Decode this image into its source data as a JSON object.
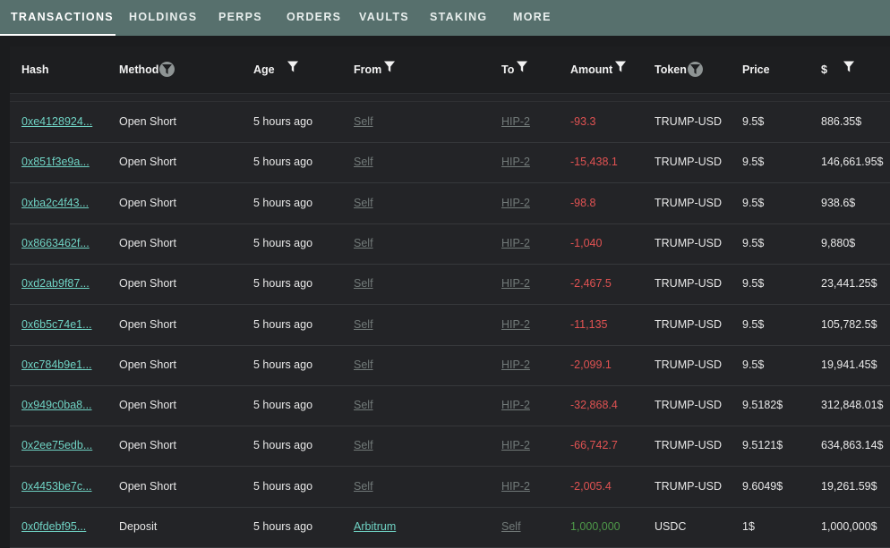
{
  "tabs": [
    {
      "label": "TRANSACTIONS",
      "active": true
    },
    {
      "label": "HOLDINGS"
    },
    {
      "label": "PERPS"
    },
    {
      "label": "ORDERS"
    },
    {
      "label": "VAULTS"
    },
    {
      "label": "STAKING"
    },
    {
      "label": "MORE"
    }
  ],
  "columns": {
    "hash": "Hash",
    "method": "Method",
    "age": "Age",
    "from": "From",
    "to": "To",
    "amount": "Amount",
    "token": "Token",
    "price": "Price",
    "usd": "$"
  },
  "rows": [
    {
      "hash": "0xe4128924...",
      "method": "Open Short",
      "age": "5 hours ago",
      "from": "Self",
      "to": "HIP-2",
      "amount": "-93.3",
      "token": "TRUMP-USD",
      "price": "9.5$",
      "usd": "886.35$"
    },
    {
      "hash": "0x851f3e9a...",
      "method": "Open Short",
      "age": "5 hours ago",
      "from": "Self",
      "to": "HIP-2",
      "amount": "-15,438.1",
      "token": "TRUMP-USD",
      "price": "9.5$",
      "usd": "146,661.95$"
    },
    {
      "hash": "0xba2c4f43...",
      "method": "Open Short",
      "age": "5 hours ago",
      "from": "Self",
      "to": "HIP-2",
      "amount": "-98.8",
      "token": "TRUMP-USD",
      "price": "9.5$",
      "usd": "938.6$"
    },
    {
      "hash": "0x8663462f...",
      "method": "Open Short",
      "age": "5 hours ago",
      "from": "Self",
      "to": "HIP-2",
      "amount": "-1,040",
      "token": "TRUMP-USD",
      "price": "9.5$",
      "usd": "9,880$"
    },
    {
      "hash": "0xd2ab9f87...",
      "method": "Open Short",
      "age": "5 hours ago",
      "from": "Self",
      "to": "HIP-2",
      "amount": "-2,467.5",
      "token": "TRUMP-USD",
      "price": "9.5$",
      "usd": "23,441.25$"
    },
    {
      "hash": "0x6b5c74e1...",
      "method": "Open Short",
      "age": "5 hours ago",
      "from": "Self",
      "to": "HIP-2",
      "amount": "-11,135",
      "token": "TRUMP-USD",
      "price": "9.5$",
      "usd": "105,782.5$"
    },
    {
      "hash": "0xc784b9e1...",
      "method": "Open Short",
      "age": "5 hours ago",
      "from": "Self",
      "to": "HIP-2",
      "amount": "-2,099.1",
      "token": "TRUMP-USD",
      "price": "9.5$",
      "usd": "19,941.45$"
    },
    {
      "hash": "0x949c0ba8...",
      "method": "Open Short",
      "age": "5 hours ago",
      "from": "Self",
      "to": "HIP-2",
      "amount": "-32,868.4",
      "token": "TRUMP-USD",
      "price": "9.5182$",
      "usd": "312,848.01$"
    },
    {
      "hash": "0x2ee75edb...",
      "method": "Open Short",
      "age": "5 hours ago",
      "from": "Self",
      "to": "HIP-2",
      "amount": "-66,742.7",
      "token": "TRUMP-USD",
      "price": "9.5121$",
      "usd": "634,863.14$"
    },
    {
      "hash": "0x4453be7c...",
      "method": "Open Short",
      "age": "5 hours ago",
      "from": "Self",
      "to": "HIP-2",
      "amount": "-2,005.4",
      "token": "TRUMP-USD",
      "price": "9.6049$",
      "usd": "19,261.59$"
    },
    {
      "hash": "0x0fdebf95...",
      "method": "Deposit",
      "age": "5 hours ago",
      "from": "Arbitrum",
      "to": "Self",
      "amount": "1,000,000",
      "token": "USDC",
      "price": "1$",
      "usd": "1,000,000$"
    }
  ],
  "colors": {
    "accent": "#6fd3c4",
    "negative": "#e05252",
    "positive": "#4e9a49",
    "tabbar": "#57706d"
  }
}
